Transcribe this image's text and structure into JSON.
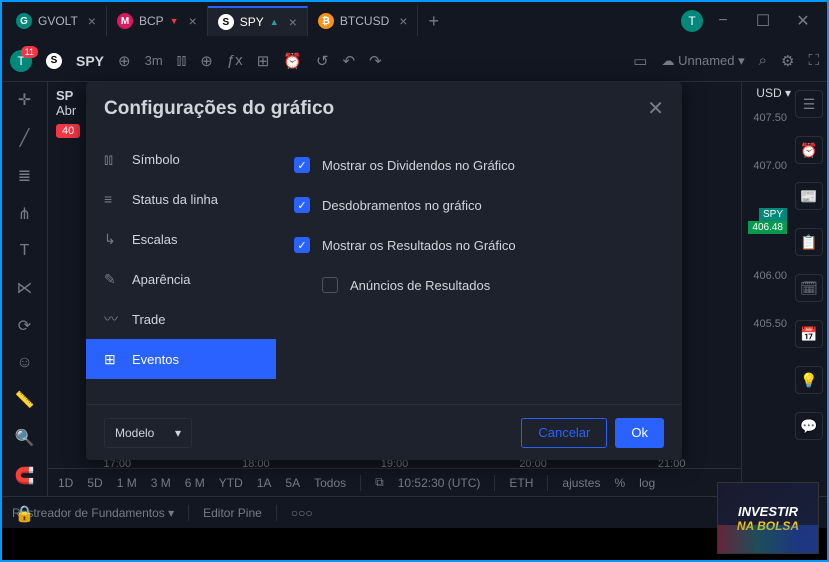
{
  "tabs": [
    {
      "icon_bg": "#00897b",
      "icon_letter": "G",
      "label": "GVOLT"
    },
    {
      "icon_bg": "#d81b60",
      "icon_letter": "M",
      "label": "BCP",
      "indicator": "▼",
      "ind_color": "#f23645"
    },
    {
      "icon_bg": "#fff",
      "icon_letter": "S",
      "label": "SPY",
      "indicator": "▲",
      "ind_color": "#26a69a",
      "active": true
    },
    {
      "icon_bg": "#f7931a",
      "icon_letter": "₿",
      "label": "BTCUSD"
    }
  ],
  "user": {
    "avatar_letter": "T",
    "badge": "11"
  },
  "toolbar": {
    "symbol_prefix": "S",
    "symbol": "SPY",
    "interval": "3m",
    "layout": "Unnamed"
  },
  "symbol": {
    "ticker": "SP",
    "desc": "Abr",
    "badge": "40"
  },
  "xaxis": [
    "17:00",
    "18:00",
    "19:00",
    "20:00",
    "21:00"
  ],
  "intervals": [
    "1D",
    "5D",
    "1 M",
    "3 M",
    "6 M",
    "YTD",
    "1A",
    "5A",
    "Todos"
  ],
  "clock": "10:52:30 (UTC)",
  "session": "ETH",
  "extra": [
    "ajustes",
    "%",
    "log"
  ],
  "currency": "USD",
  "prices": {
    "p1": "407.50",
    "p2": "407.00",
    "tag_sym": "SPY",
    "tag_val": "406.48",
    "p3": "406.00",
    "p4": "405.50"
  },
  "bottom": {
    "screener": "Rastreador de Fundamentos",
    "pine": "Editor Pine"
  },
  "modal": {
    "title": "Configurações do gráfico",
    "side": [
      "Símbolo",
      "Status da linha",
      "Escalas",
      "Aparência",
      "Trade",
      "Eventos"
    ],
    "opts": {
      "o1": "Mostrar os Dividendos no Gráfico",
      "o2": "Desdobramentos no gráfico",
      "o3": "Mostrar os Resultados no Gráfico",
      "o4": "Anúncios de Resultados"
    },
    "template": "Modelo",
    "cancel": "Cancelar",
    "ok": "Ok"
  },
  "promo": {
    "l1": "INVESTIR",
    "l2": "NA BOLSA"
  }
}
